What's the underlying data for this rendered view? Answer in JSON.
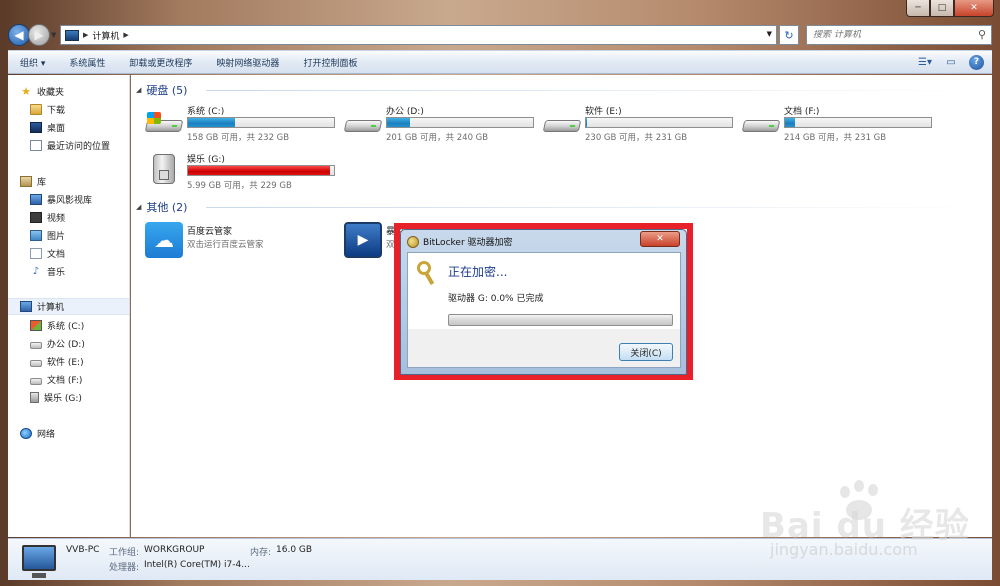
{
  "window": {
    "minimize_label": "─",
    "maximize_label": "□",
    "close_label": "✕"
  },
  "address_bar": {
    "crumbs": [
      "计算机"
    ],
    "search_placeholder": "搜索 计算机"
  },
  "toolbar": {
    "organize_label": "组织 ▾",
    "system_properties_label": "系统属性",
    "uninstall_label": "卸载或更改程序",
    "map_drive_label": "映射网络驱动器",
    "control_panel_label": "打开控制面板"
  },
  "nav_pane": {
    "favorites_label": "收藏夹",
    "favorites": [
      "下载",
      "桌面",
      "最近访问的位置"
    ],
    "libraries_label": "库",
    "libraries": [
      "暴风影视库",
      "视频",
      "图片",
      "文档",
      "音乐"
    ],
    "computer_label": "计算机",
    "drives": [
      "系统 (C:)",
      "办公 (D:)",
      "软件 (E:)",
      "文档 (F:)",
      "娱乐 (G:)"
    ],
    "network_label": "网络"
  },
  "content": {
    "hard_disks_header": "硬盘 (5)",
    "drives": [
      {
        "name": "系统 (C:)",
        "size_text": "158 GB 可用，共 232 GB",
        "used_fraction": 0.32
      },
      {
        "name": "办公 (D:)",
        "size_text": "201 GB 可用，共 240 GB",
        "used_fraction": 0.16
      },
      {
        "name": "软件 (E:)",
        "size_text": "230 GB 可用，共 231 GB",
        "used_fraction": 0.004
      },
      {
        "name": "文档 (F:)",
        "size_text": "214 GB 可用，共 231 GB",
        "used_fraction": 0.07
      },
      {
        "name": "娱乐 (G:)",
        "size_text": "5.99 GB 可用，共 229 GB",
        "used_fraction": 0.974
      }
    ],
    "other_header": "其他 (2)",
    "others": [
      {
        "name": "百度云管家",
        "desc": "双击运行百度云管家"
      },
      {
        "name": "暴风",
        "desc": "双"
      }
    ]
  },
  "details": {
    "pc_name": "VVB-PC",
    "workgroup_label": "工作组:",
    "workgroup_value": "WORKGROUP",
    "memory_label": "内存:",
    "memory_value": "16.0 GB",
    "processor_label": "处理器:",
    "processor_value": "Intel(R) Core(TM) i7-4..."
  },
  "dialog": {
    "title": "BitLocker 驱动器加密",
    "close_label": "✕",
    "heading": "正在加密...",
    "status": "驱动器 G: 0.0% 已完成",
    "progress_fraction": 0.0,
    "button_label": "关闭(C)"
  },
  "watermark": {
    "text": "Bai du 经验",
    "url": "jingyan.baidu.com"
  },
  "colors": {
    "drive_bar": "#1c7fbf",
    "drive_bar_full": "#cc0000",
    "highlight": "#e8202a",
    "group_header": "#1e3f8a"
  },
  "icons": {
    "back": "arrow-left-icon",
    "forward": "arrow-right-icon",
    "refresh": "refresh-icon",
    "search": "search-icon",
    "help": "help-icon"
  }
}
